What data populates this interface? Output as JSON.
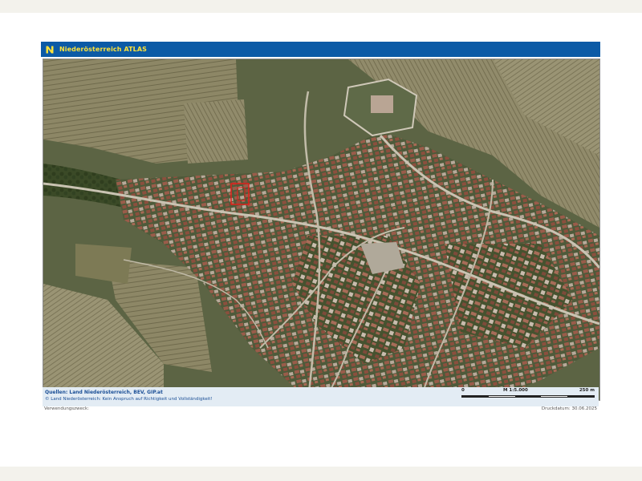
{
  "header": {
    "title": "Niederösterreich ATLAS",
    "logo_icon": "noe-logo-icon",
    "bg_color": "#0b5aa6",
    "title_color": "#ffe23a"
  },
  "map": {
    "kind": "aerial orthophoto",
    "marker_color": "#e0201b"
  },
  "footer": {
    "sources": "Quellen: Land Niederösterreich, BEV, GIP.at",
    "copyright": "© Land Niederösterreich: Kein Anspruch auf Richtigkeit und Vollständigkeit!",
    "scale": {
      "start": "0",
      "ratio": "M 1:5.000",
      "end": "250 m"
    },
    "usage": "Verwendungszweck:",
    "print_date": "Druckdatum: 30.06.2025"
  }
}
